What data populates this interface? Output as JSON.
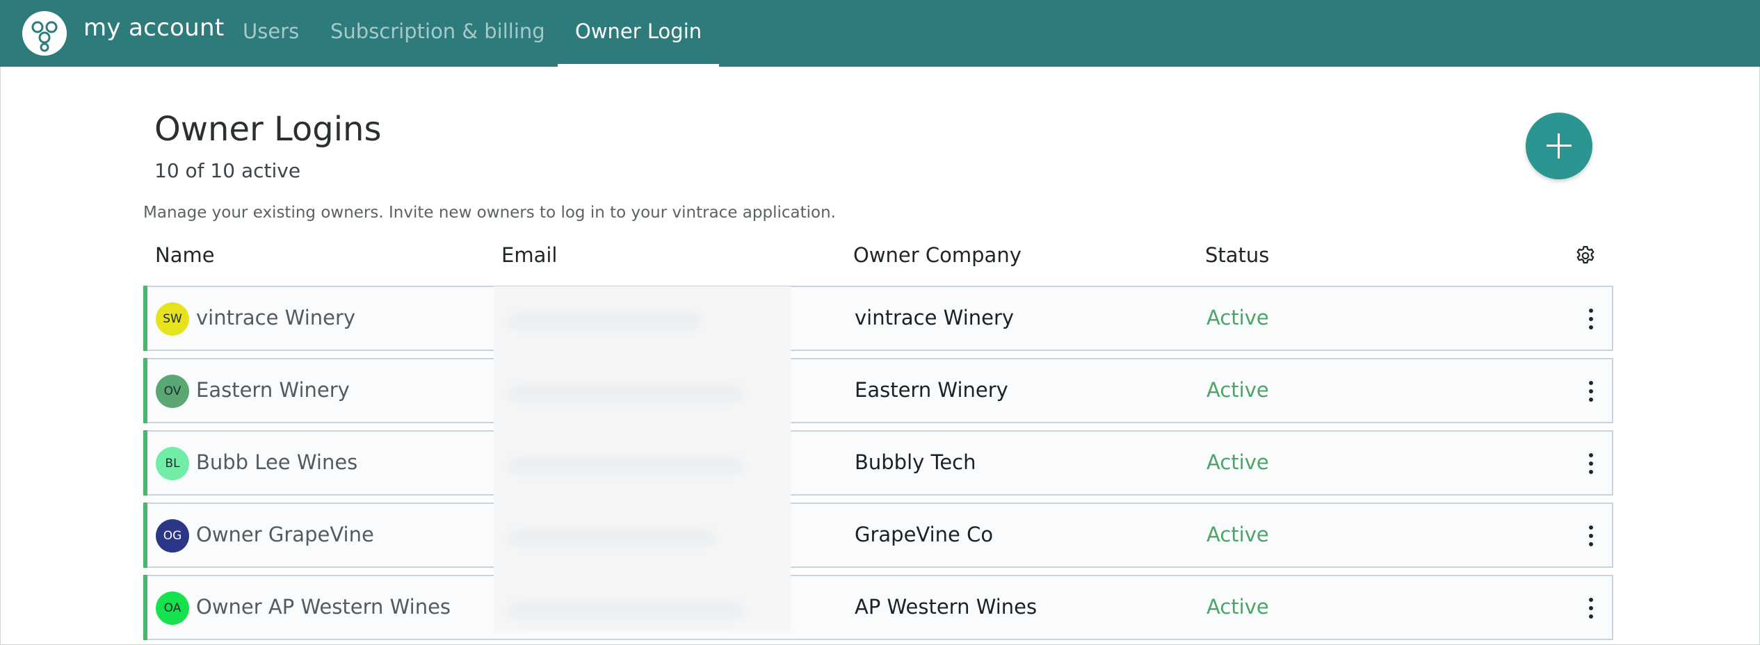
{
  "topbar": {
    "brand": "my account",
    "nav": [
      "Users",
      "Subscription & billing",
      "Owner Login"
    ],
    "active_tab": "Owner Login"
  },
  "page": {
    "title": "Owner Logins",
    "active_count": "10 of 10 active",
    "description": "Manage your existing owners. Invite new owners to log in to your vintrace application."
  },
  "table": {
    "headers": {
      "name": "Name",
      "email": "Email",
      "company": "Owner Company",
      "status": "Status"
    },
    "rows": [
      {
        "initials": "SW",
        "avatar_color": "#e6e21e",
        "name": "vintrace Winery",
        "company": "vintrace Winery",
        "status": "Active"
      },
      {
        "initials": "OV",
        "avatar_color": "#5aa774",
        "name": "Eastern Winery",
        "company": "Eastern Winery",
        "status": "Active"
      },
      {
        "initials": "BL",
        "avatar_color": "#72eda8",
        "name": "Bubb Lee Wines",
        "company": "Bubbly Tech",
        "status": "Active"
      },
      {
        "initials": "OG",
        "avatar_color": "#2b3687",
        "name": "Owner GrapeVine",
        "company": "GrapeVine Co",
        "status": "Active"
      },
      {
        "initials": "OA",
        "avatar_color": "#15e24c",
        "name": "Owner AP Western Wines",
        "company": "AP Western Wines",
        "status": "Active"
      }
    ]
  },
  "icons": {
    "logo": "grape-cluster-icon",
    "add": "plus-icon",
    "settings": "gear-icon",
    "row_menu": "more-vertical-icon"
  },
  "colors": {
    "topbar": "#2e7b7c",
    "accent_button": "#2b9592",
    "status_active": "#4aa567",
    "row_accent": "#45b86b"
  }
}
